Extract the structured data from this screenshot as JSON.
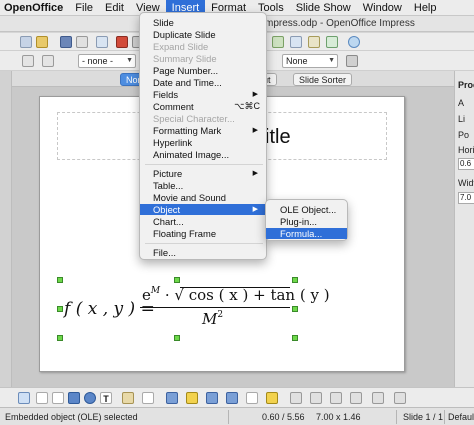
{
  "menubar": {
    "items": [
      {
        "label": "OpenOffice"
      },
      {
        "label": "File"
      },
      {
        "label": "Edit"
      },
      {
        "label": "View"
      },
      {
        "label": "Insert"
      },
      {
        "label": "Format"
      },
      {
        "label": "Tools"
      },
      {
        "label": "Slide Show"
      },
      {
        "label": "Window"
      },
      {
        "label": "Help"
      }
    ]
  },
  "window": {
    "title": "mpress.odp - OpenOffice Impress"
  },
  "toolbar": {
    "style_select": "- none -",
    "line_select": "None"
  },
  "view_tabs": [
    {
      "label": "Nor"
    },
    {
      "label": "lout"
    },
    {
      "label": "Slide Sorter"
    }
  ],
  "insert_menu": {
    "items": [
      {
        "label": "Slide",
        "disabled": false
      },
      {
        "label": "Duplicate Slide",
        "disabled": false
      },
      {
        "label": "Expand Slide",
        "disabled": true
      },
      {
        "label": "Summary Slide",
        "disabled": true
      },
      {
        "label": "Page Number...",
        "disabled": false
      },
      {
        "label": "Date and Time...",
        "disabled": false
      },
      {
        "label": "Fields",
        "disabled": false,
        "submenu": true
      },
      {
        "label": "Comment",
        "disabled": false,
        "shortcut": "⌥⌘C"
      },
      {
        "label": "Special Character...",
        "disabled": true
      },
      {
        "label": "Formatting Mark",
        "disabled": false,
        "submenu": true
      },
      {
        "label": "Hyperlink",
        "disabled": false
      },
      {
        "label": "Animated Image...",
        "disabled": false
      },
      {
        "label": "Picture",
        "disabled": false,
        "submenu": true
      },
      {
        "label": "Table...",
        "disabled": false
      },
      {
        "label": "Movie and Sound",
        "disabled": false
      },
      {
        "label": "Object",
        "disabled": false,
        "submenu": true,
        "highlighted": true
      },
      {
        "label": "Chart...",
        "disabled": false
      },
      {
        "label": "Floating Frame",
        "disabled": false
      },
      {
        "label": "File...",
        "disabled": false
      }
    ]
  },
  "object_submenu": {
    "items": [
      {
        "label": "OLE Object...",
        "highlighted": false
      },
      {
        "label": "Plug-in...",
        "highlighted": false
      },
      {
        "label": "Formula...",
        "highlighted": true
      }
    ]
  },
  "slide": {
    "title_fragment": "itle",
    "formula": {
      "lhs": "f ( x , y ) =",
      "num_base": "e",
      "num_exp": "M",
      "num_rest": "· √ cos ( x ) + tan ( y )",
      "den_base": "M",
      "den_exp": "2"
    }
  },
  "right_panel": {
    "labels": [
      "Proc",
      "A",
      "Li",
      "Po",
      "Horiz",
      "0.6",
      "Widt",
      "7.0"
    ]
  },
  "statusbar": {
    "message": "Embedded object (OLE) selected",
    "position": "0.60 / 5.56",
    "size": "7.00 x 1.46",
    "slide": "Slide 1 / 1",
    "layout": "Default"
  },
  "colors": {
    "accent": "#2f6fd8",
    "handle": "#6ed84a"
  }
}
